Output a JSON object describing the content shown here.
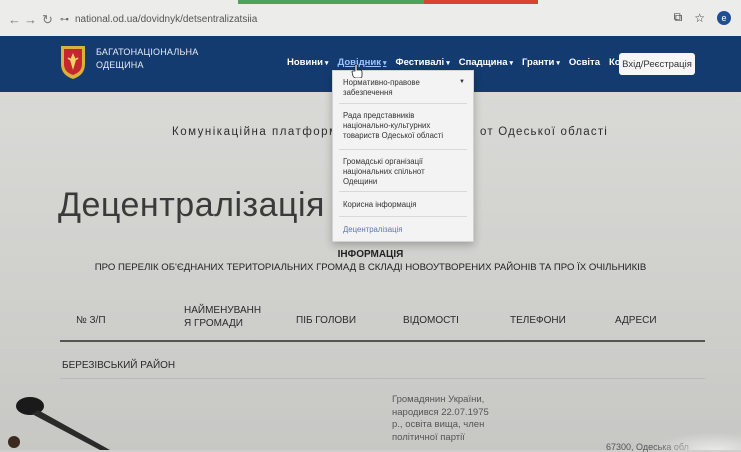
{
  "browser": {
    "back_icon": "back-arrow-icon",
    "forward_icon": "forward-arrow-icon",
    "reload_icon": "reload-icon",
    "url": "national.od.ua/dovidnyk/detsentralizatsiia",
    "profile_initial": "e"
  },
  "header": {
    "brand_line1": "БАГАТОНАЦІОНАЛЬНА",
    "brand_line2": "ОДЕЩИНА",
    "nav": [
      {
        "label": "Новини",
        "caret": "▾"
      },
      {
        "label": "Довідник",
        "caret": "▾"
      },
      {
        "label": "Фестивалі",
        "caret": "▾"
      },
      {
        "label": "Спадщина",
        "caret": "▾"
      },
      {
        "label": "Гранти",
        "caret": "▾"
      },
      {
        "label": "Освіта",
        "caret": ""
      },
      {
        "label": "Контакти",
        "caret": ""
      }
    ],
    "login_label": "Вхід/Реєстрація"
  },
  "dropdown": {
    "items": [
      "Нормативно-правове забезпечення",
      "Рада представників національно-культурних товариств Одеської області",
      "Громадські організації національних спільнот Одещини",
      "Корисна інформація",
      "Децентралізація"
    ]
  },
  "page": {
    "subtitle_left": "Комунікаційна платформ",
    "subtitle_right": "от Одеської області",
    "title": "Децентралізація",
    "info_title": "ІНФОРМАЦІЯ",
    "info_subtitle": "ПРО ПЕРЕЛІК ОБ'ЄДНАНИХ ТЕРИТОРІАЛЬНИХ ГРОМАД В СКЛАДІ НОВОУТВОРЕНИХ РАЙОНІВ ТА ПРО ЇХ ОЧІЛЬНИКІВ",
    "table_headers": [
      "№ З/П",
      "НАЙМЕНУВАНН Я ГРОМАДИ",
      "ПІБ ГОЛОВИ",
      "ВІДОМОСТІ",
      "ТЕЛЕФОНИ",
      "АДРЕСИ"
    ],
    "region": "БЕРЕЗІВСЬКИЙ РАЙОН",
    "info_cell_lines": [
      "Громадянин України,",
      "народився 22.07.1975",
      "р., освіта вища, член",
      "політичної партії"
    ],
    "address_cell": "67300, Одеська обл"
  }
}
